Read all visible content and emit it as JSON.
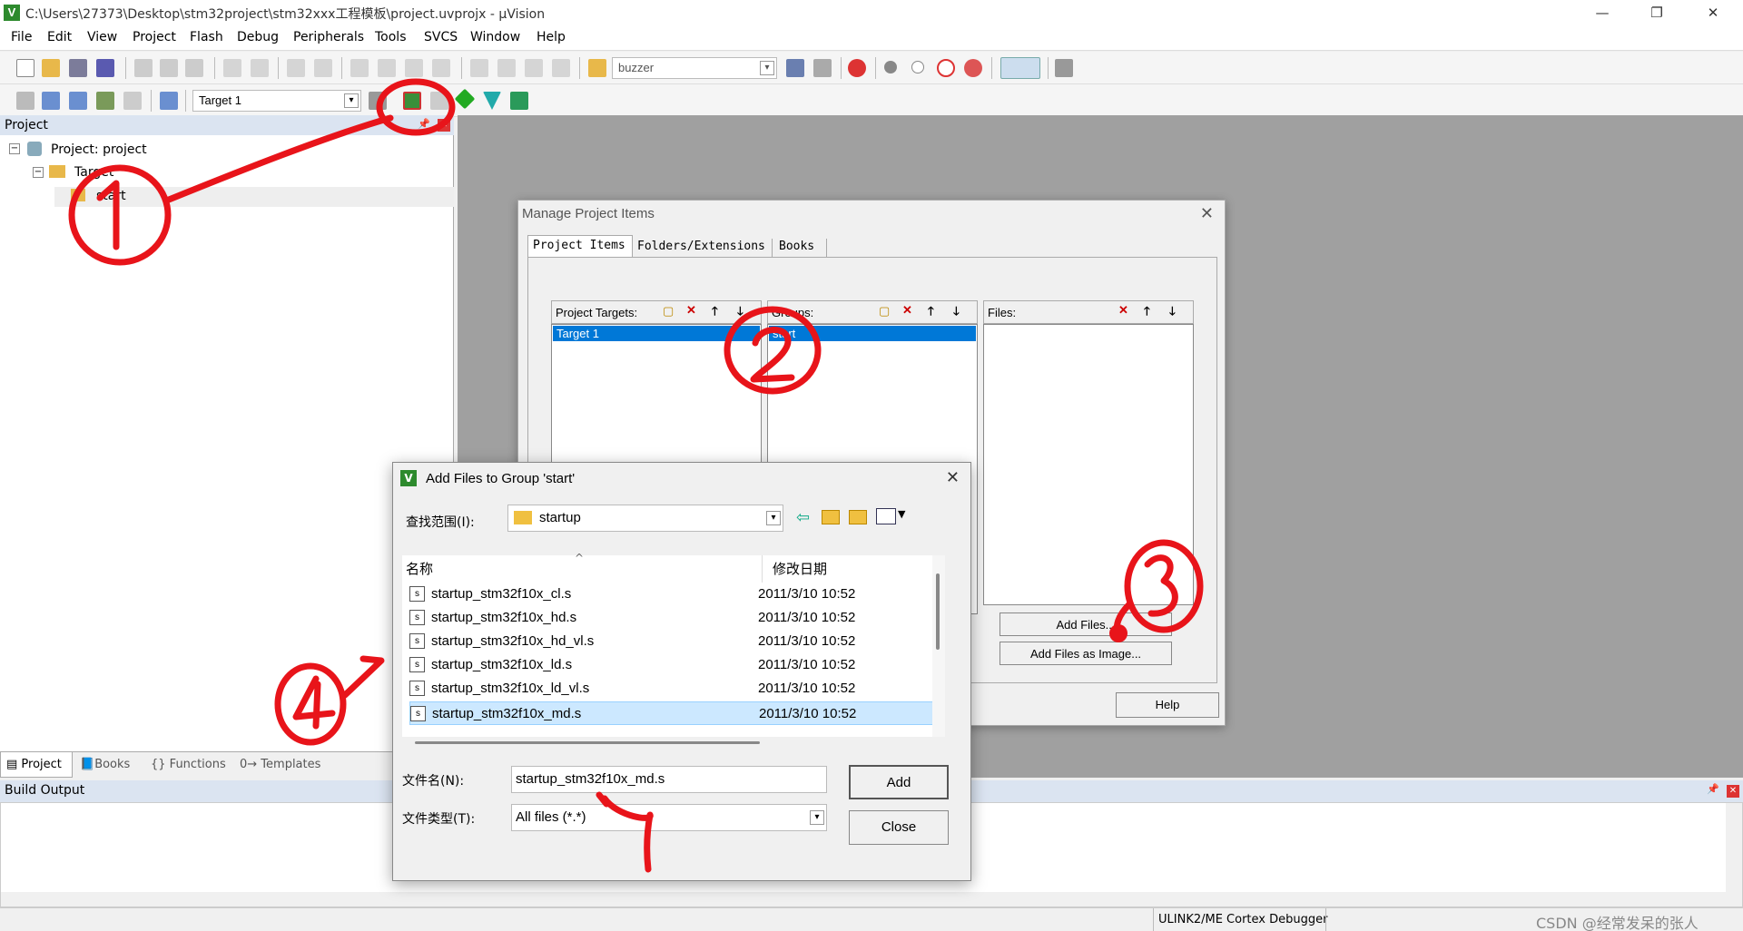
{
  "window": {
    "title": "C:\\Users\\27373\\Desktop\\stm32project\\stm32xxx工程模板\\project.uvprojx - µVision"
  },
  "menu": [
    "File",
    "Edit",
    "View",
    "Project",
    "Flash",
    "Debug",
    "Peripherals",
    "Tools",
    "SVCS",
    "Window",
    "Help"
  ],
  "toolbar": {
    "find_combo": "buzzer",
    "target_combo": "Target 1"
  },
  "project_panel": {
    "header": "Project",
    "root": "Project: project",
    "target": "Target",
    "group": "start",
    "tabs": [
      "Project",
      "Books",
      "{} Functions",
      "0→ Templates"
    ]
  },
  "manage_dialog": {
    "title": "Manage Project Items",
    "tabs": [
      "Project Items",
      "Folders/Extensions",
      "Books"
    ],
    "targets_label": "Project Targets:",
    "groups_label": "Groups:",
    "files_label": "Files:",
    "selected_target": "Target 1",
    "selected_group": "start",
    "add_files": "Add Files...",
    "add_files_image": "Add Files as Image...",
    "help": "Help"
  },
  "add_dialog": {
    "title": "Add Files to Group 'start'",
    "lookin_label": "查找范围(I):",
    "lookin_value": "startup",
    "col_name": "名称",
    "col_date": "修改日期",
    "files": [
      {
        "name": "startup_stm32f10x_cl.s",
        "date": "2011/3/10 10:52"
      },
      {
        "name": "startup_stm32f10x_hd.s",
        "date": "2011/3/10 10:52"
      },
      {
        "name": "startup_stm32f10x_hd_vl.s",
        "date": "2011/3/10 10:52"
      },
      {
        "name": "startup_stm32f10x_ld.s",
        "date": "2011/3/10 10:52"
      },
      {
        "name": "startup_stm32f10x_ld_vl.s",
        "date": "2011/3/10 10:52"
      },
      {
        "name": "startup_stm32f10x_md.s",
        "date": "2011/3/10 10:52"
      }
    ],
    "filename_label": "文件名(N):",
    "filename_value": "startup_stm32f10x_md.s",
    "filetype_label": "文件类型(T):",
    "filetype_value": "All files (*.*)",
    "add": "Add",
    "close": "Close"
  },
  "build_output": {
    "header": "Build Output"
  },
  "status": {
    "debugger": "ULINK2/ME Cortex Debugger",
    "watermark": "CSDN @经常发呆的张人"
  },
  "annotations": [
    "1",
    "2",
    "3",
    "4",
    "7"
  ]
}
